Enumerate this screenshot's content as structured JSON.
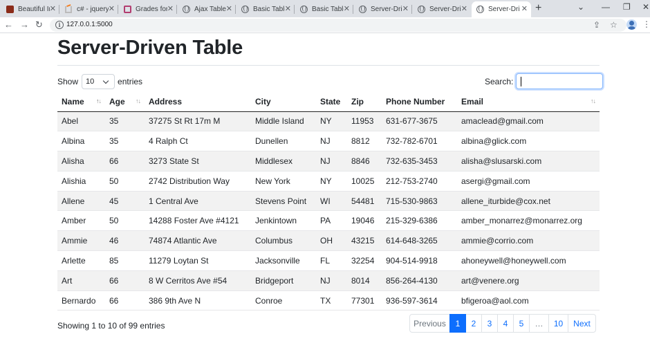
{
  "browser": {
    "tabs": [
      {
        "title": "Beautiful In",
        "favicon": "image-favicon",
        "active": false
      },
      {
        "title": "c# - jquery",
        "favicon": "stackoverflow-favicon",
        "active": false
      },
      {
        "title": "Grades for",
        "favicon": "grades-favicon",
        "active": false
      },
      {
        "title": "Ajax Table",
        "favicon": "globe-icon",
        "active": false
      },
      {
        "title": "Basic Table",
        "favicon": "globe-icon",
        "active": false
      },
      {
        "title": "Basic Table",
        "favicon": "globe-icon",
        "active": false
      },
      {
        "title": "Server-Dri",
        "favicon": "globe-icon",
        "active": false
      },
      {
        "title": "Server-Dri",
        "favicon": "globe-icon",
        "active": false
      },
      {
        "title": "Server-Dri",
        "favicon": "globe-icon",
        "active": true
      }
    ],
    "url": "127.0.0.1:5000"
  },
  "page": {
    "title": "Server-Driven Table",
    "length_prefix": "Show",
    "length_value": "10",
    "length_suffix": "entries",
    "search_label": "Search:",
    "search_value": ""
  },
  "table": {
    "columns": [
      {
        "label": "Name",
        "sortable": true,
        "sorted": "asc"
      },
      {
        "label": "Age",
        "sortable": true,
        "sorted": null
      },
      {
        "label": "Address",
        "sortable": false,
        "sorted": null
      },
      {
        "label": "City",
        "sortable": false,
        "sorted": null
      },
      {
        "label": "State",
        "sortable": false,
        "sorted": null
      },
      {
        "label": "Zip",
        "sortable": false,
        "sorted": null
      },
      {
        "label": "Phone Number",
        "sortable": false,
        "sorted": null
      },
      {
        "label": "Email",
        "sortable": true,
        "sorted": null
      }
    ],
    "rows": [
      [
        "Abel",
        "35",
        "37275 St Rt 17m M",
        "Middle Island",
        "NY",
        "11953",
        "631-677-3675",
        "amaclead@gmail.com"
      ],
      [
        "Albina",
        "35",
        "4 Ralph Ct",
        "Dunellen",
        "NJ",
        "8812",
        "732-782-6701",
        "albina@glick.com"
      ],
      [
        "Alisha",
        "66",
        "3273 State St",
        "Middlesex",
        "NJ",
        "8846",
        "732-635-3453",
        "alisha@slusarski.com"
      ],
      [
        "Alishia",
        "50",
        "2742 Distribution Way",
        "New York",
        "NY",
        "10025",
        "212-753-2740",
        "asergi@gmail.com"
      ],
      [
        "Allene",
        "45",
        "1 Central Ave",
        "Stevens Point",
        "WI",
        "54481",
        "715-530-9863",
        "allene_iturbide@cox.net"
      ],
      [
        "Amber",
        "50",
        "14288 Foster Ave #4121",
        "Jenkintown",
        "PA",
        "19046",
        "215-329-6386",
        "amber_monarrez@monarrez.org"
      ],
      [
        "Ammie",
        "46",
        "74874 Atlantic Ave",
        "Columbus",
        "OH",
        "43215",
        "614-648-3265",
        "ammie@corrio.com"
      ],
      [
        "Arlette",
        "85",
        "11279 Loytan St",
        "Jacksonville",
        "FL",
        "32254",
        "904-514-9918",
        "ahoneywell@honeywell.com"
      ],
      [
        "Art",
        "66",
        "8 W Cerritos Ave #54",
        "Bridgeport",
        "NJ",
        "8014",
        "856-264-4130",
        "art@venere.org"
      ],
      [
        "Bernardo",
        "66",
        "386 9th Ave N",
        "Conroe",
        "TX",
        "77301",
        "936-597-3614",
        "bfigeroa@aol.com"
      ]
    ]
  },
  "footer": {
    "info": "Showing 1 to 10 of 99 entries",
    "pagination": [
      {
        "label": "Previous",
        "current": false
      },
      {
        "label": "1",
        "current": true
      },
      {
        "label": "2",
        "current": false
      },
      {
        "label": "3",
        "current": false
      },
      {
        "label": "4",
        "current": false
      },
      {
        "label": "5",
        "current": false
      },
      {
        "label": "…",
        "current": false
      },
      {
        "label": "10",
        "current": false
      },
      {
        "label": "Next",
        "current": false
      }
    ]
  },
  "colors": {
    "accent": "#0d6efd",
    "stripe": "#f2f2f2",
    "tabstrip": "#dee1e6"
  }
}
